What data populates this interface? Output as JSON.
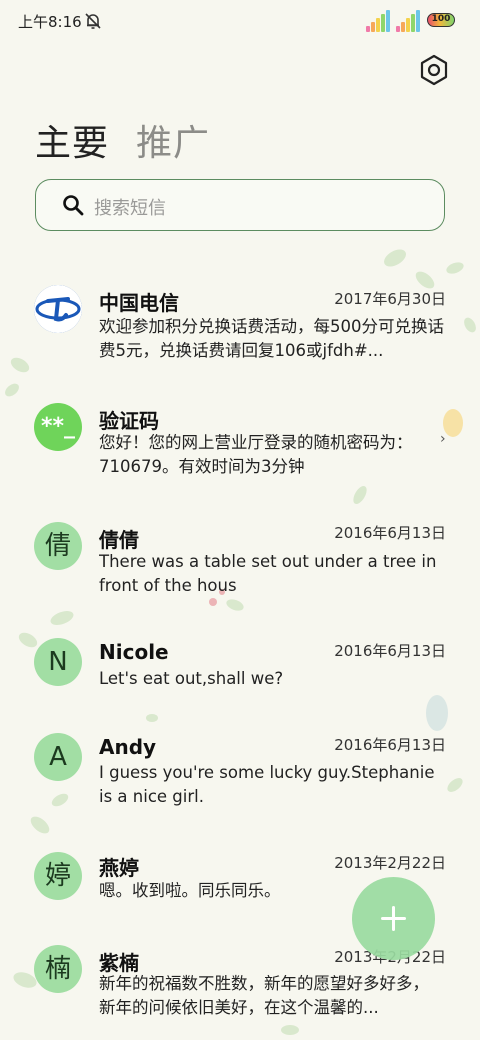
{
  "status_bar": {
    "time": "上午8:16",
    "battery": "100"
  },
  "tabs": [
    {
      "label": "主要"
    },
    {
      "label": "推广"
    }
  ],
  "search": {
    "placeholder": "搜索短信"
  },
  "conversations": [
    {
      "sender": "中国电信",
      "date": "2017年6月30日",
      "preview": "欢迎参加积分兑换话费活动，每500分可兑换话费5元，兑换话费请回复106或jfdh#...",
      "avatar": "telecom-logo"
    },
    {
      "sender": "验证码",
      "date": "",
      "preview": "您好！您的网上营业厅登录的随机密码为：710679。有效时间为3分钟",
      "avatar_text": "**_"
    },
    {
      "sender": "倩倩",
      "date": "2016年6月13日",
      "preview": "There was a table set out under a tree in front of the hous",
      "avatar_text": "倩"
    },
    {
      "sender": "Nicole",
      "date": "2016年6月13日",
      "preview": "Let's eat out,shall we?",
      "avatar_text": "N"
    },
    {
      "sender": "Andy",
      "date": "2016年6月13日",
      "preview": "I guess you're some lucky guy.Stephanie is a nice girl.",
      "avatar_text": "A"
    },
    {
      "sender": "燕婷",
      "date": "2013年2月22日",
      "preview": "嗯。收到啦。同乐同乐。",
      "avatar_text": "婷"
    },
    {
      "sender": "紫楠",
      "date": "2013年2月22日",
      "preview": "新年的祝福数不胜数，新年的愿望好多好多，新年的问候依旧美好，在这个温馨的...",
      "avatar_text": "楠"
    }
  ],
  "colors": {
    "accent": "#5c8c60",
    "avatar_bg": "#a2dea4",
    "verify_avatar": "#6fd45a",
    "fab": "#99dba0"
  },
  "icons": {
    "settings": "settings-hexagon-icon",
    "search": "search-icon",
    "add": "plus-icon",
    "mute": "bell-off-icon"
  }
}
